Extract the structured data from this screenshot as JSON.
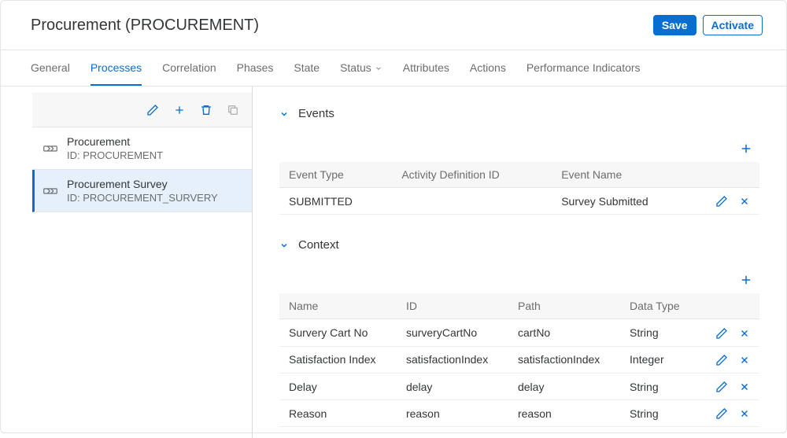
{
  "header": {
    "title": "Procurement (PROCUREMENT)",
    "save": "Save",
    "activate": "Activate"
  },
  "tabs": {
    "items": [
      "General",
      "Processes",
      "Correlation",
      "Phases",
      "State",
      "Status",
      "Attributes",
      "Actions",
      "Performance Indicators"
    ],
    "active": 1,
    "dropdown_index": 5
  },
  "sidebar": {
    "items": [
      {
        "title": "Procurement",
        "id_label": "ID: PROCUREMENT"
      },
      {
        "title": "Procurement Survey",
        "id_label": "ID: PROCUREMENT_SURVERY"
      }
    ],
    "selected": 1
  },
  "events": {
    "title": "Events",
    "headers": [
      "Event Type",
      "Activity Definition ID",
      "Event Name"
    ],
    "rows": [
      {
        "type": "SUBMITTED",
        "activity": "",
        "name": "Survey Submitted"
      }
    ]
  },
  "context": {
    "title": "Context",
    "headers": [
      "Name",
      "ID",
      "Path",
      "Data Type"
    ],
    "rows": [
      {
        "name": "Survery Cart No",
        "id": "surveryCartNo",
        "path": "cartNo",
        "dtype": "String"
      },
      {
        "name": "Satisfaction Index",
        "id": "satisfactionIndex",
        "path": "satisfactionIndex",
        "dtype": "Integer"
      },
      {
        "name": "Delay",
        "id": "delay",
        "path": "delay",
        "dtype": "String"
      },
      {
        "name": "Reason",
        "id": "reason",
        "path": "reason",
        "dtype": "String"
      }
    ]
  }
}
